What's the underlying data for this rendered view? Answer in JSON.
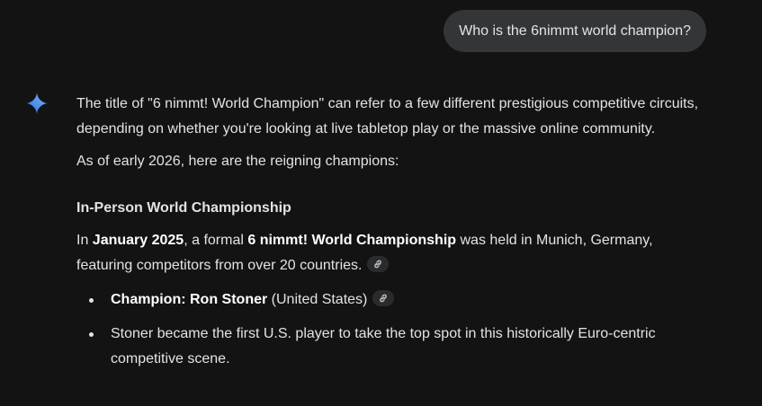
{
  "user_message": {
    "text": "Who is the 6nimmt world champion?"
  },
  "response": {
    "intro": "The title of \"6 nimmt! World Champion\" can refer to a few different prestigious competitive circuits, depending on whether you're looking at live tabletop play or the massive online community.",
    "as_of": "As of early 2026, here are the reigning champions:",
    "section_heading": "In-Person World Championship",
    "body": {
      "prefix": "In ",
      "date_bold": "January 2025",
      "middle": ", a formal ",
      "event_bold": "6 nimmt! World Championship",
      "suffix": " was held in Munich, Germany, featuring competitors from over 20 countries."
    },
    "bullets": [
      {
        "bold": "Champion: Ron Stoner",
        "rest": " (United States)",
        "has_link": true
      },
      {
        "bold": "",
        "rest": "Stoner became the first U.S. player to take the top spot in this historically Euro-centric competitive scene.",
        "has_link": false
      }
    ]
  },
  "icons": {
    "assistant": "gemini-sparkle-icon",
    "source_link": "link-icon"
  },
  "colors": {
    "background": "#131314",
    "user_bubble": "#333537",
    "text": "#e3e3e3",
    "sparkle_gradient_start": "#4285f4",
    "sparkle_gradient_end": "#8ab4f8"
  }
}
